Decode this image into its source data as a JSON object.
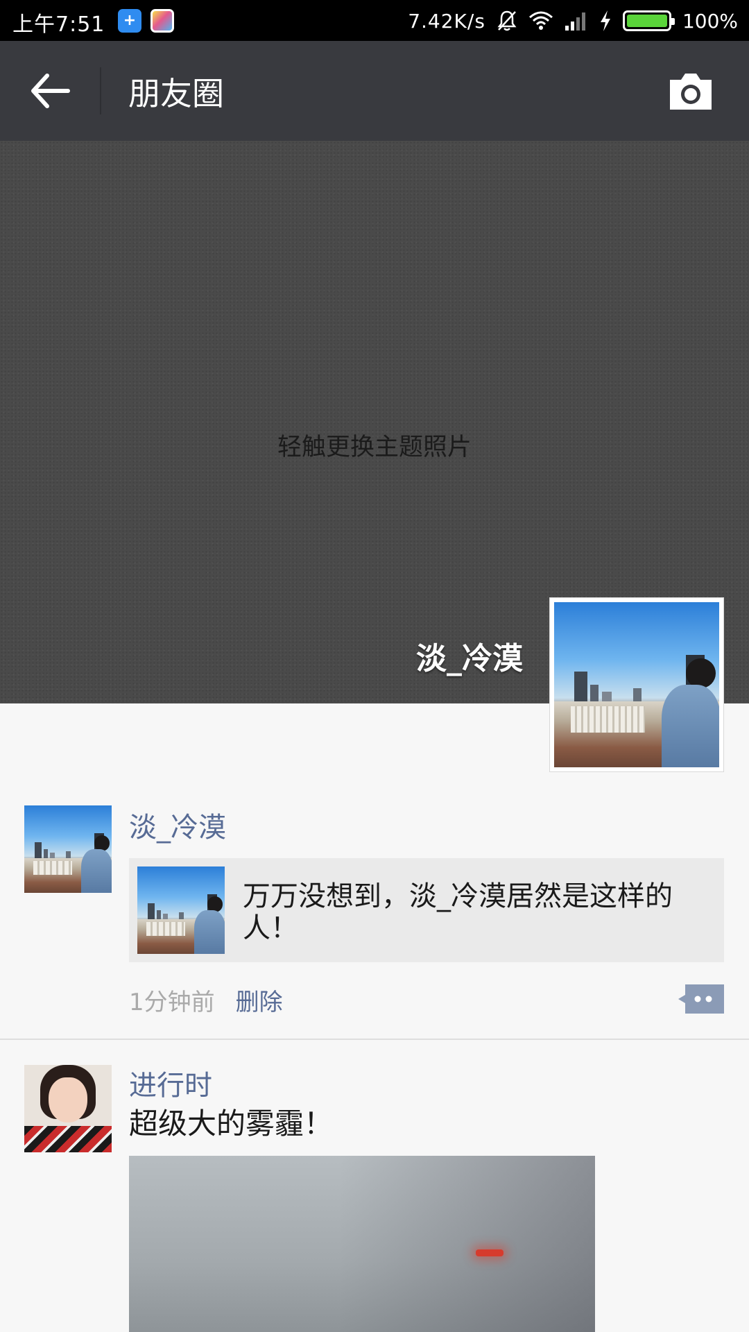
{
  "status_bar": {
    "time": "上午7:51",
    "network_speed": "7.42K/s",
    "battery": "100%",
    "battery_level": 1.0,
    "icons": [
      "app-icon-plus",
      "app-icon-colorful",
      "mute-icon",
      "wifi-icon",
      "signal-icon",
      "charging-icon",
      "battery-icon"
    ]
  },
  "nav": {
    "title": "朋友圈",
    "back_icon": "arrow-left-icon",
    "camera_icon": "camera-icon"
  },
  "cover": {
    "hint": "轻触更换主题照片",
    "user_name": "淡_冷漠"
  },
  "posts": [
    {
      "author": "淡_冷漠",
      "share_text": "万万没想到，淡_冷漠居然是这样的人！",
      "time": "1分钟前",
      "delete_label": "删除"
    },
    {
      "author": "进行时",
      "text": "超级大的雾霾！"
    }
  ],
  "colors": {
    "nav_bg": "#393a3f",
    "link_blue": "#576b95",
    "page_bg": "#f7f7f7",
    "share_bg": "#eaeaea"
  }
}
